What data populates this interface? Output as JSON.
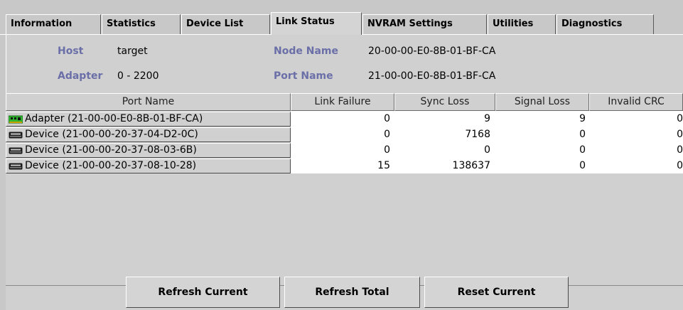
{
  "tabs": [
    {
      "label": "Information"
    },
    {
      "label": "Statistics"
    },
    {
      "label": "Device List"
    },
    {
      "label": "Link Status"
    },
    {
      "label": "NVRAM Settings"
    },
    {
      "label": "Utilities"
    },
    {
      "label": "Diagnostics"
    }
  ],
  "info": {
    "host_label": "Host",
    "host_value": "target",
    "adapter_label": "Adapter",
    "adapter_value": "0 - 2200",
    "node_name_label": "Node Name",
    "node_name_value": "20-00-00-E0-8B-01-BF-CA",
    "port_name_label": "Port Name",
    "port_name_value": "21-00-00-E0-8B-01-BF-CA"
  },
  "table": {
    "columns": [
      "Port Name",
      "Link Failure",
      "Sync Loss",
      "Signal Loss",
      "Invalid CRC"
    ],
    "rows": [
      {
        "icon": "adapter-card-icon",
        "name": "Adapter (21-00-00-E0-8B-01-BF-CA)",
        "link_failure": "0",
        "sync_loss": "9",
        "signal_loss": "9",
        "invalid_crc": "0"
      },
      {
        "icon": "disk-device-icon",
        "name": "Device (21-00-00-20-37-04-D2-0C)",
        "link_failure": "0",
        "sync_loss": "7168",
        "signal_loss": "0",
        "invalid_crc": "0"
      },
      {
        "icon": "disk-device-icon",
        "name": "Device (21-00-00-20-37-08-03-6B)",
        "link_failure": "0",
        "sync_loss": "0",
        "signal_loss": "0",
        "invalid_crc": "0"
      },
      {
        "icon": "disk-device-icon",
        "name": "Device (21-00-00-20-37-08-10-28)",
        "link_failure": "15",
        "sync_loss": "138637",
        "signal_loss": "0",
        "invalid_crc": "0"
      }
    ]
  },
  "buttons": {
    "refresh_current": "Refresh Current",
    "refresh_total": "Refresh Total",
    "reset_current": "Reset Current"
  },
  "colors": {
    "label_accent": "#6b6fa8",
    "adapter_icon": "#2fb52f"
  }
}
